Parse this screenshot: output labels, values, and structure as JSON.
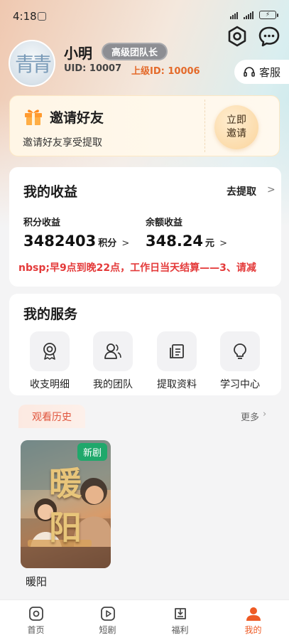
{
  "status_bar": {
    "time": "4:18"
  },
  "profile": {
    "name": "小明",
    "role": "高级团队长",
    "uid": "UID: 10007",
    "parent_id": "上级ID: 10006",
    "avatar_text": "青青"
  },
  "header": {
    "service_label": "客服"
  },
  "invite": {
    "title": "邀请好友",
    "subtitle": "邀请好友享受提取",
    "button_line1": "立即",
    "button_line2": "邀请"
  },
  "earnings": {
    "title": "我的收益",
    "withdraw_label": "去提取",
    "points_label": "积分收益",
    "points_value": "3482403",
    "points_unit": "积分",
    "balance_label": "余额收益",
    "balance_value": "348.24",
    "balance_unit": "元",
    "notice": "nbsp;早9点到晚22点，工作日当天结算——3、请减"
  },
  "services": {
    "title": "我的服务",
    "items": [
      {
        "label": "收支明细",
        "icon": "medal-icon"
      },
      {
        "label": "我的团队",
        "icon": "team-icon"
      },
      {
        "label": "提取资料",
        "icon": "document-icon"
      },
      {
        "label": "学习中心",
        "icon": "lightbulb-icon"
      }
    ]
  },
  "history": {
    "tab_label": "观看历史",
    "more_label": "更多",
    "items": [
      {
        "title": "暖阳",
        "badge": "新剧",
        "poster_text_1": "暖",
        "poster_text_2": "阳"
      }
    ]
  },
  "tabbar": {
    "items": [
      {
        "label": "首页",
        "icon": "home-icon"
      },
      {
        "label": "短剧",
        "icon": "play-icon"
      },
      {
        "label": "福利",
        "icon": "gift-box-icon"
      },
      {
        "label": "我的",
        "icon": "profile-icon"
      }
    ],
    "active_index": 3,
    "active_color": "#ee5a24"
  }
}
